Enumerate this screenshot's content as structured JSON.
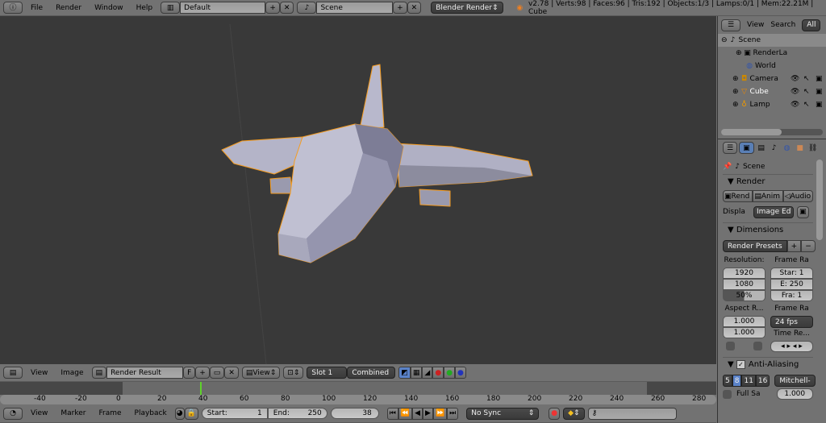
{
  "topbar": {
    "menus": [
      "File",
      "Render",
      "Window",
      "Help"
    ],
    "layout": "Default",
    "scene": "Scene",
    "engine": "Blender Render",
    "stats": "v2.78 | Verts:98 | Faces:96 | Tris:192 | Objects:1/3 | Lamps:0/1 | Mem:22.21M | Cube"
  },
  "outliner": {
    "view": "View",
    "search": "Search",
    "filter": "All",
    "items": [
      {
        "label": "Scene"
      },
      {
        "label": "RenderLa"
      },
      {
        "label": "World"
      },
      {
        "label": "Camera"
      },
      {
        "label": "Cube"
      },
      {
        "label": "Lamp"
      }
    ]
  },
  "properties": {
    "scene": "Scene",
    "render_panel": "Render",
    "render_btn": "Rend",
    "anim_btn": "Anim",
    "audio_btn": "Audio",
    "display_label": "Displa",
    "display_value": "Image Ed",
    "dimensions": "Dimensions",
    "presets": "Render Presets",
    "resolution_label": "Resolution:",
    "res_x": "1920",
    "res_y": "1080",
    "res_pct": "50%",
    "res_pct_value": 50,
    "frame_range_label": "Frame Ra",
    "start": "Star: 1",
    "end": "E: 250",
    "step": "Fra: 1",
    "aspect_label": "Aspect R...",
    "aspect_x": "1.000",
    "aspect_y": "1.000",
    "frame_rate_label": "Frame Ra",
    "fps": "24 fps",
    "time_remap_label": "Time Re...",
    "aa_label": "Anti-Aliasing",
    "aa_samples": [
      "5",
      "8",
      "11",
      "16"
    ],
    "aa_selected": "8",
    "filter": "Mitchell-",
    "full_sample": "Full Sa",
    "filter_size": "1.000"
  },
  "image_editor": {
    "menus": [
      "View",
      "Image"
    ],
    "image": "Render Result",
    "fake": "F",
    "view": "View",
    "slot": "Slot 1",
    "pass": "Combined"
  },
  "timeline": {
    "ticks": [
      "-40",
      "-20",
      "0",
      "20",
      "40",
      "60",
      "80",
      "100",
      "120",
      "140",
      "160",
      "180",
      "200",
      "220",
      "240",
      "260",
      "280"
    ],
    "current_frame": 38,
    "menus": [
      "View",
      "Marker",
      "Frame",
      "Playback"
    ],
    "start_label": "Start:",
    "start": "1",
    "end_label": "End:",
    "end": "250",
    "frame": "38",
    "sync": "No Sync"
  },
  "colors": {
    "selection_outline": "#f59c20",
    "current_frame": "#5fd12b",
    "mesh": "#b4b4c8"
  }
}
